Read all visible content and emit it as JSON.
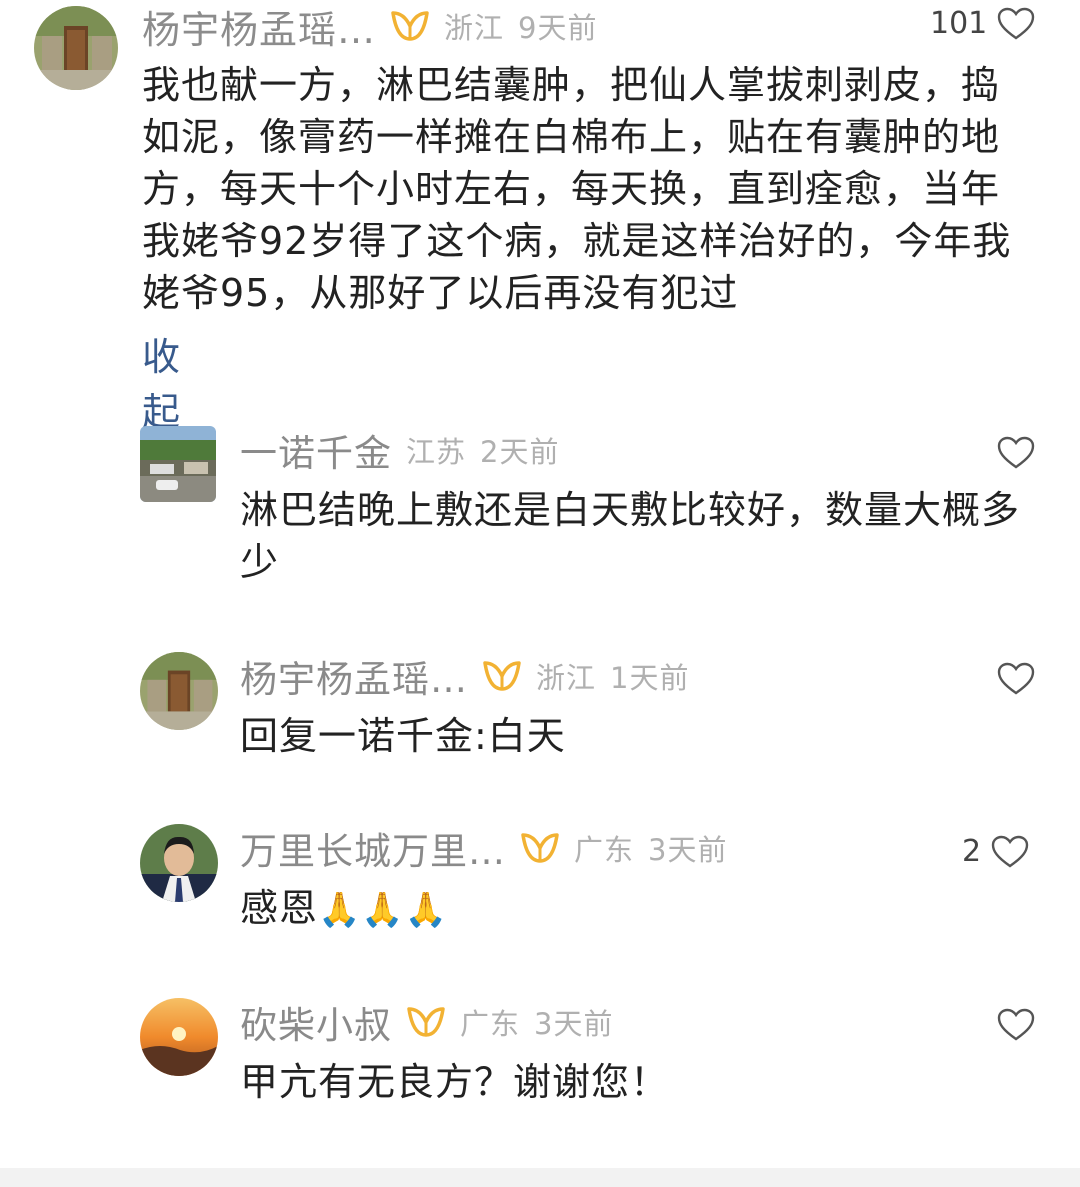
{
  "comments": [
    {
      "name": "杨宇杨孟瑶…",
      "location": "浙江",
      "time": "9天前",
      "likes": "101",
      "lines": [
        "我也献一方，淋巴结囊肿，把仙人掌拔刺剥皮，捣",
        "如泥，像膏药一样摊在白棉布上，贴在有囊肿的地",
        "方，每天十个小时左右，每天换，直到痊愈，当年",
        "我姥爷92岁得了这个病，就是这样治好的，今年我",
        "姥爷95，从那好了以后再没有犯过"
      ],
      "collapse": "收起"
    },
    {
      "name": "一诺千金",
      "location": "江苏",
      "time": "2天前",
      "likes": "",
      "lines": [
        "淋巴结晚上敷还是白天敷比较好，数量大概多",
        "少"
      ]
    },
    {
      "name": "杨宇杨孟瑶…",
      "location": "浙江",
      "time": "1天前",
      "likes": "",
      "lines": [
        "回复一诺千金:白天"
      ]
    },
    {
      "name": "万里长城万里…",
      "location": "广东",
      "time": "3天前",
      "likes": "2",
      "text": "感恩",
      "emoji": "🙏🙏🙏"
    },
    {
      "name": "砍柴小叔",
      "location": "广东",
      "time": "3天前",
      "likes": "",
      "lines": [
        "甲亢有无良方？谢谢您！"
      ]
    }
  ],
  "colors": {
    "accent_badge": "#f2b233",
    "link": "#385a8c"
  }
}
